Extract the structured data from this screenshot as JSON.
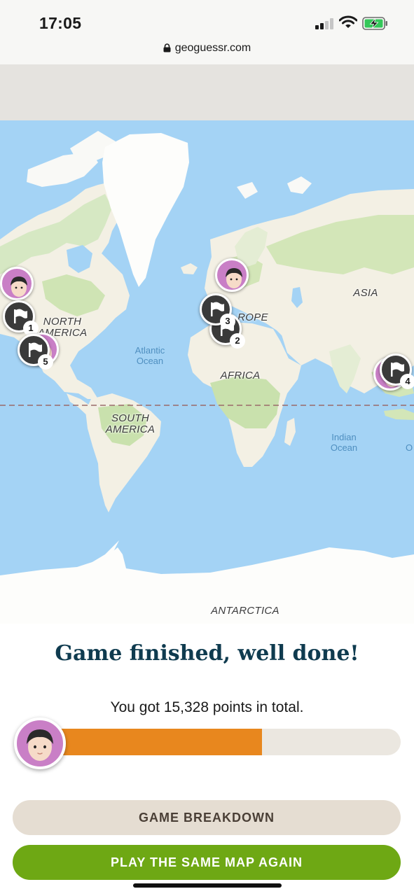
{
  "status_bar": {
    "time": "17:05",
    "signal_icon": "cellular-signal-icon",
    "wifi_icon": "wifi-icon",
    "battery_icon": "battery-charging-icon"
  },
  "browser": {
    "url": "geoguessr.com",
    "lock_icon": "lock-icon"
  },
  "map": {
    "continent_labels": {
      "north_america": "NORTH\nAMERICA",
      "south_america": "SOUTH\nAMERICA",
      "europe": "ROPE",
      "africa": "AFRICA",
      "asia": "ASIA",
      "antarctica": "ANTARCTICA"
    },
    "ocean_labels": {
      "atlantic": "Atlantic\nOcean",
      "indian": "Indian\nOcean",
      "cut_off": "O"
    },
    "round_markers": [
      {
        "number": "1",
        "icon": "flag-icon"
      },
      {
        "number": "2",
        "icon": "flag-icon"
      },
      {
        "number": "3",
        "icon": "flag-icon"
      },
      {
        "number": "4",
        "icon": "flag-icon"
      },
      {
        "number": "5",
        "icon": "flag-icon"
      }
    ],
    "colors": {
      "ocean": "#a4d3f5",
      "land": "#f3f0e4",
      "vegetation": "#d3e6b8",
      "ice": "#ffffff",
      "equator_line": "#9a6a6a"
    }
  },
  "result": {
    "title": "Game finished, well done!",
    "score_text": "You got 15,328 points in total.",
    "score_fraction": 0.613,
    "progress_color": "#e8871e",
    "buttons": {
      "breakdown": "GAME BREAKDOWN",
      "play_again": "PLAY THE SAME MAP AGAIN"
    }
  }
}
